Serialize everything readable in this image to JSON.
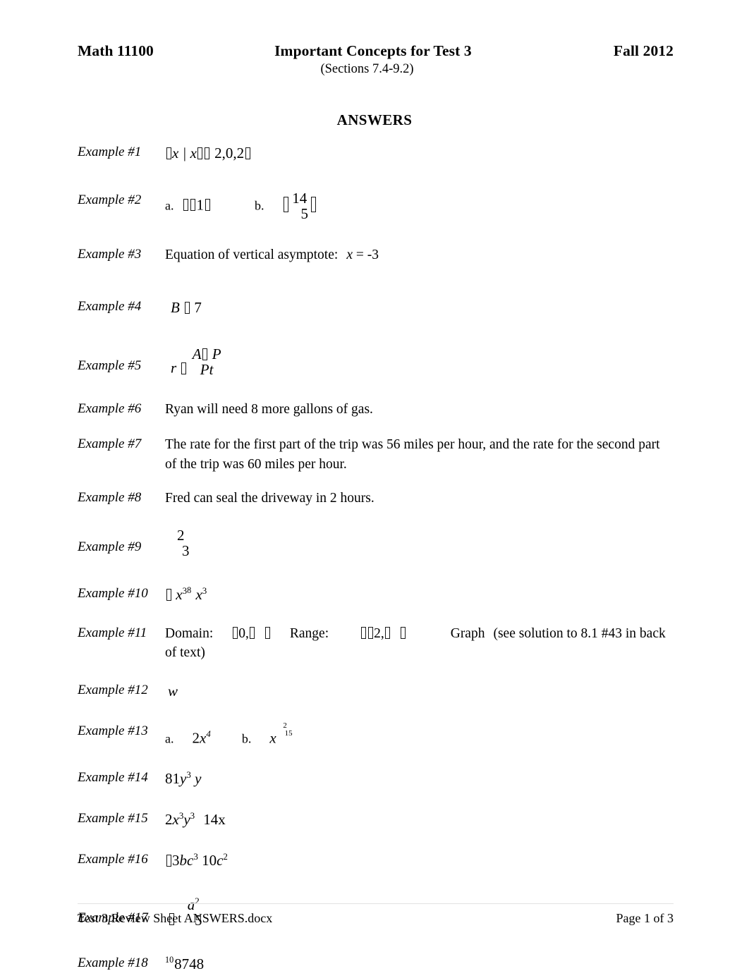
{
  "header": {
    "course": "Math 11100",
    "title": "Important Concepts for Test 3",
    "term": "Fall 2012",
    "subtitle": "(Sections 7.4-9.2)"
  },
  "answers_heading": "ANSWERS",
  "examples": [
    {
      "label": "Example #1",
      "plain_text": "{ x | x ≠ −2, 0, 2 }",
      "parts": {
        "set_body": "x | x",
        "values": "2,0,2"
      }
    },
    {
      "label": "Example #2",
      "plain_text": "a.  {−1}        b.  { 14/5 }",
      "parts": {
        "a_marker": "a.",
        "a_value": "1",
        "b_marker": "b.",
        "b_num": "14",
        "b_den": "5"
      }
    },
    {
      "label": "Example #3",
      "plain_text": "Equation of vertical asymptote:  x = -3",
      "parts": {
        "text": "Equation of vertical asymptote:",
        "variable": "x",
        "equals_value": "= -3"
      }
    },
    {
      "label": "Example #4",
      "plain_text": "B = 7",
      "parts": {
        "variable": "B",
        "value": "7"
      }
    },
    {
      "label": "Example #5",
      "plain_text": "r = (A − P) / (Pt)",
      "parts": {
        "variable": "r",
        "num_left": "A",
        "num_right": "P",
        "den": "Pt"
      }
    },
    {
      "label": "Example #6",
      "plain_text": "Ryan will need 8 more gallons of gas.",
      "parts": {
        "text": "Ryan will need 8 more gallons of gas."
      }
    },
    {
      "label": "Example #7",
      "plain_text": "The rate for the first part of the trip was 56 miles per hour, and the rate for the second part of the trip was 60 miles per hour.",
      "parts": {
        "text": "The rate for the first part of the trip was 56 miles per hour, and the rate for the second part of the trip was 60 miles per hour."
      }
    },
    {
      "label": "Example #8",
      "plain_text": "Fred can seal the driveway in 2 hours.",
      "parts": {
        "text": "Fred can seal the driveway in 2 hours."
      }
    },
    {
      "label": "Example #9",
      "plain_text": "2/3",
      "parts": {
        "num": "2",
        "den": "3"
      }
    },
    {
      "label": "Example #10",
      "plain_text": "−x³ ⁸√(x³)",
      "parts": {
        "base": "x",
        "exp": "3",
        "index": "8",
        "rad_base": "x",
        "rad_exp": "3"
      }
    },
    {
      "label": "Example #11",
      "plain_text": "Domain: [0, ∞)   Range: [−2, ∞)   Graph (see solution to 8.1 #43 in back of text)",
      "parts": {
        "domain_label": "Domain:",
        "domain_value": "0,",
        "range_label": "Range:",
        "range_value": "2,",
        "graph_label": "Graph",
        "graph_note": "(see solution to 8.1 #43 in back of text)"
      }
    },
    {
      "label": "Example #12",
      "plain_text": "w",
      "parts": {
        "value": "w"
      }
    },
    {
      "label": "Example #13",
      "plain_text": "a.  2x⁴      b.  x^(2/15)",
      "parts": {
        "a_marker": "a.",
        "a_coeff": "2",
        "a_base": "x",
        "a_exp": "4",
        "b_marker": "b.",
        "b_base": "x",
        "b_exp_num": "2",
        "b_exp_den": "15"
      }
    },
    {
      "label": "Example #14",
      "plain_text": "81y³ √y",
      "parts": {
        "coeff": "81",
        "base": "y",
        "exp": "3",
        "rad": "y"
      }
    },
    {
      "label": "Example #15",
      "plain_text": "2x³y³ √(14x)",
      "parts": {
        "coeff": "2",
        "base1": "x",
        "exp1": "3",
        "base2": "y",
        "exp2": "3",
        "rad": "14x"
      }
    },
    {
      "label": "Example #16",
      "plain_text": "−3bc³ ∛(10c²)",
      "parts": {
        "coeff": "3",
        "vars": "bc",
        "exp": "3",
        "rad_num": "10",
        "rad_var": "c",
        "rad_exp": "2"
      }
    },
    {
      "label": "Example #17",
      "plain_text": "− a²/5",
      "parts": {
        "num_base": "a",
        "num_exp": "2",
        "den": "5"
      }
    },
    {
      "label": "Example #18",
      "plain_text": "¹⁰√8748",
      "parts": {
        "index": "10",
        "radicand": "8748"
      }
    }
  ],
  "footer": {
    "filename": "Test 3 Review Sheet ANSWERS.docx",
    "page": "Page 1 of 3"
  }
}
